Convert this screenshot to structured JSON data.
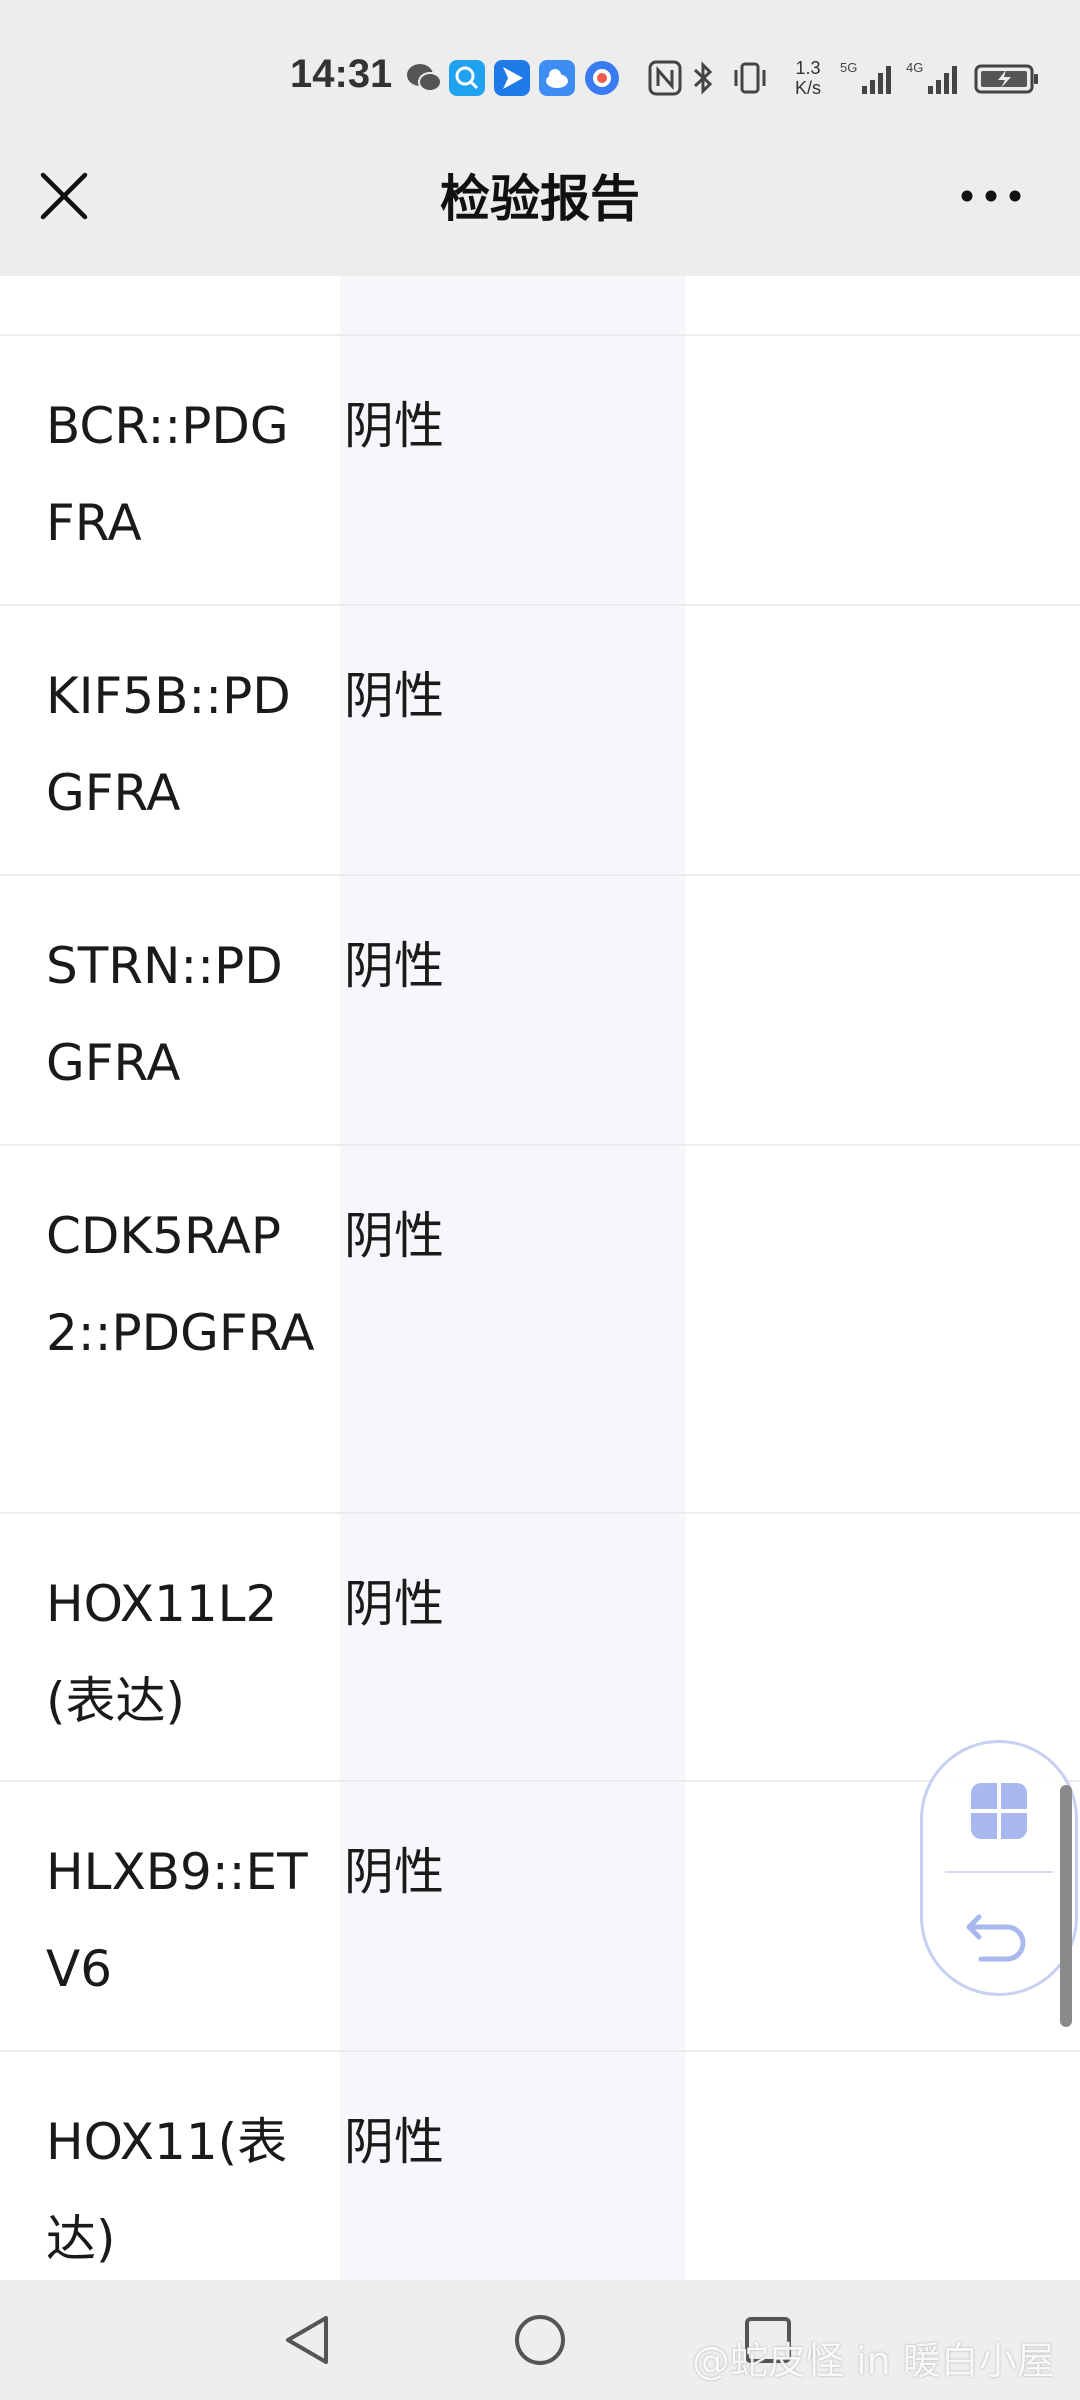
{
  "status_bar": {
    "time": "14:31",
    "net_speed_value": "1.3",
    "net_speed_unit": "K/s",
    "icons": [
      "wechat-icon",
      "search-app-icon",
      "navigation-app-icon",
      "cloud-app-icon",
      "browser-app-icon",
      "nfc-icon",
      "bluetooth-icon",
      "vibrate-icon",
      "signal-5g-icon",
      "signal-4g-icon",
      "battery-icon"
    ]
  },
  "header": {
    "title": "检验报告"
  },
  "table": {
    "rows": [
      {
        "name": "BCR::PDGFRA",
        "result": "阴性"
      },
      {
        "name": "KIF5B::PDGFRA",
        "result": "阴性"
      },
      {
        "name": "STRN::PDGFRA",
        "result": "阴性"
      },
      {
        "name": "CDK5RAP2::PDGFRA",
        "result": "阴性"
      },
      {
        "name": "HOX11L2(表达)",
        "result": "阴性"
      },
      {
        "name": "HLXB9::ETV6",
        "result": "阴性"
      },
      {
        "name": "HOX11(表达)",
        "result": "阴性"
      }
    ]
  },
  "floating_widget": {
    "icons": [
      "app-grid-icon",
      "return-icon"
    ],
    "accent": "#a9b8ef"
  },
  "nav_bar": {
    "icons": [
      "back-triangle-icon",
      "home-circle-icon",
      "recents-square-icon"
    ]
  },
  "watermark": "@蛇皮怪 in 暖白小屋"
}
